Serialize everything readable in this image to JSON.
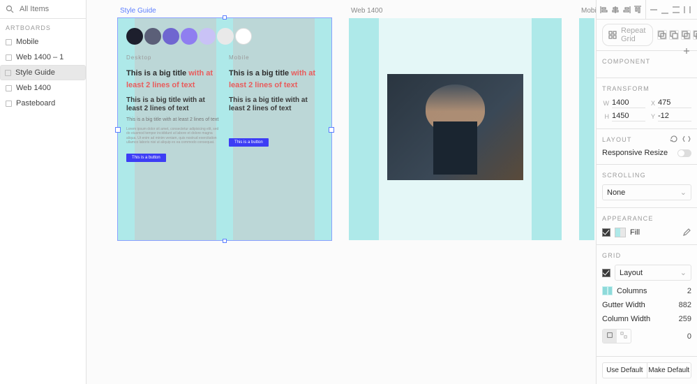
{
  "search_placeholder": "All Items",
  "artboards_header": "ARTBOARDS",
  "artboards": [
    {
      "label": "Mobile",
      "selected": false
    },
    {
      "label": "Web 1400 – 1",
      "selected": false
    },
    {
      "label": "Style Guide",
      "selected": true
    },
    {
      "label": "Web 1400",
      "selected": false
    },
    {
      "label": "Pasteboard",
      "selected": false
    }
  ],
  "canvas": {
    "style_guide": {
      "label": "Style Guide",
      "swatches": [
        "#1d1f2d",
        "#5b5f78",
        "#6f66d0",
        "#8f7ef0",
        "#c9c2f6",
        "#e9e9e9",
        "#ffffff"
      ],
      "desktop": {
        "heading": "Desktop",
        "title_plain": "This is a big title ",
        "title_hot": "with at least 2 lines of text",
        "subtitle": "This is a big title with at least 2 lines of text",
        "body": "This is a big title with at least 2 lines of text",
        "lorem": "Lorem ipsum dolor sit amet, consectetur adipisicing elit, sed do eiusmod tempor incididunt ut labore et dolore magna aliqua. Ut enim ad minim veniam, quis nostrud exercitation ullamco laboris nisi ut aliquip ex ea commodo consequat.",
        "button": "This is a button"
      },
      "mobile": {
        "heading": "Mobile",
        "title_plain": "This is a big title ",
        "title_hot": "with at least 2 lines of text",
        "subtitle": "This is a big title with at least 2 lines of text",
        "button": "This is a button"
      }
    },
    "web1400": {
      "label": "Web 1400"
    },
    "mobile": {
      "label": "Mobile"
    }
  },
  "props": {
    "repeat_grid": "Repeat Grid",
    "component": {
      "header": "COMPONENT"
    },
    "transform": {
      "header": "TRANSFORM",
      "w_lbl": "W",
      "w": "1400",
      "x_lbl": "X",
      "x": "475",
      "h_lbl": "H",
      "h": "1450",
      "y_lbl": "Y",
      "y": "-12"
    },
    "layout": {
      "header": "LAYOUT",
      "responsive": "Responsive Resize"
    },
    "scrolling": {
      "header": "SCROLLING",
      "value": "None"
    },
    "appearance": {
      "header": "APPEARANCE",
      "fill": "Fill"
    },
    "grid": {
      "header": "GRID",
      "mode": "Layout",
      "columns_lbl": "Columns",
      "columns": "2",
      "gutter_lbl": "Gutter Width",
      "gutter": "882",
      "colw_lbl": "Column Width",
      "colw": "259",
      "margin": "0",
      "use_default": "Use Default",
      "make_default": "Make Default"
    }
  }
}
